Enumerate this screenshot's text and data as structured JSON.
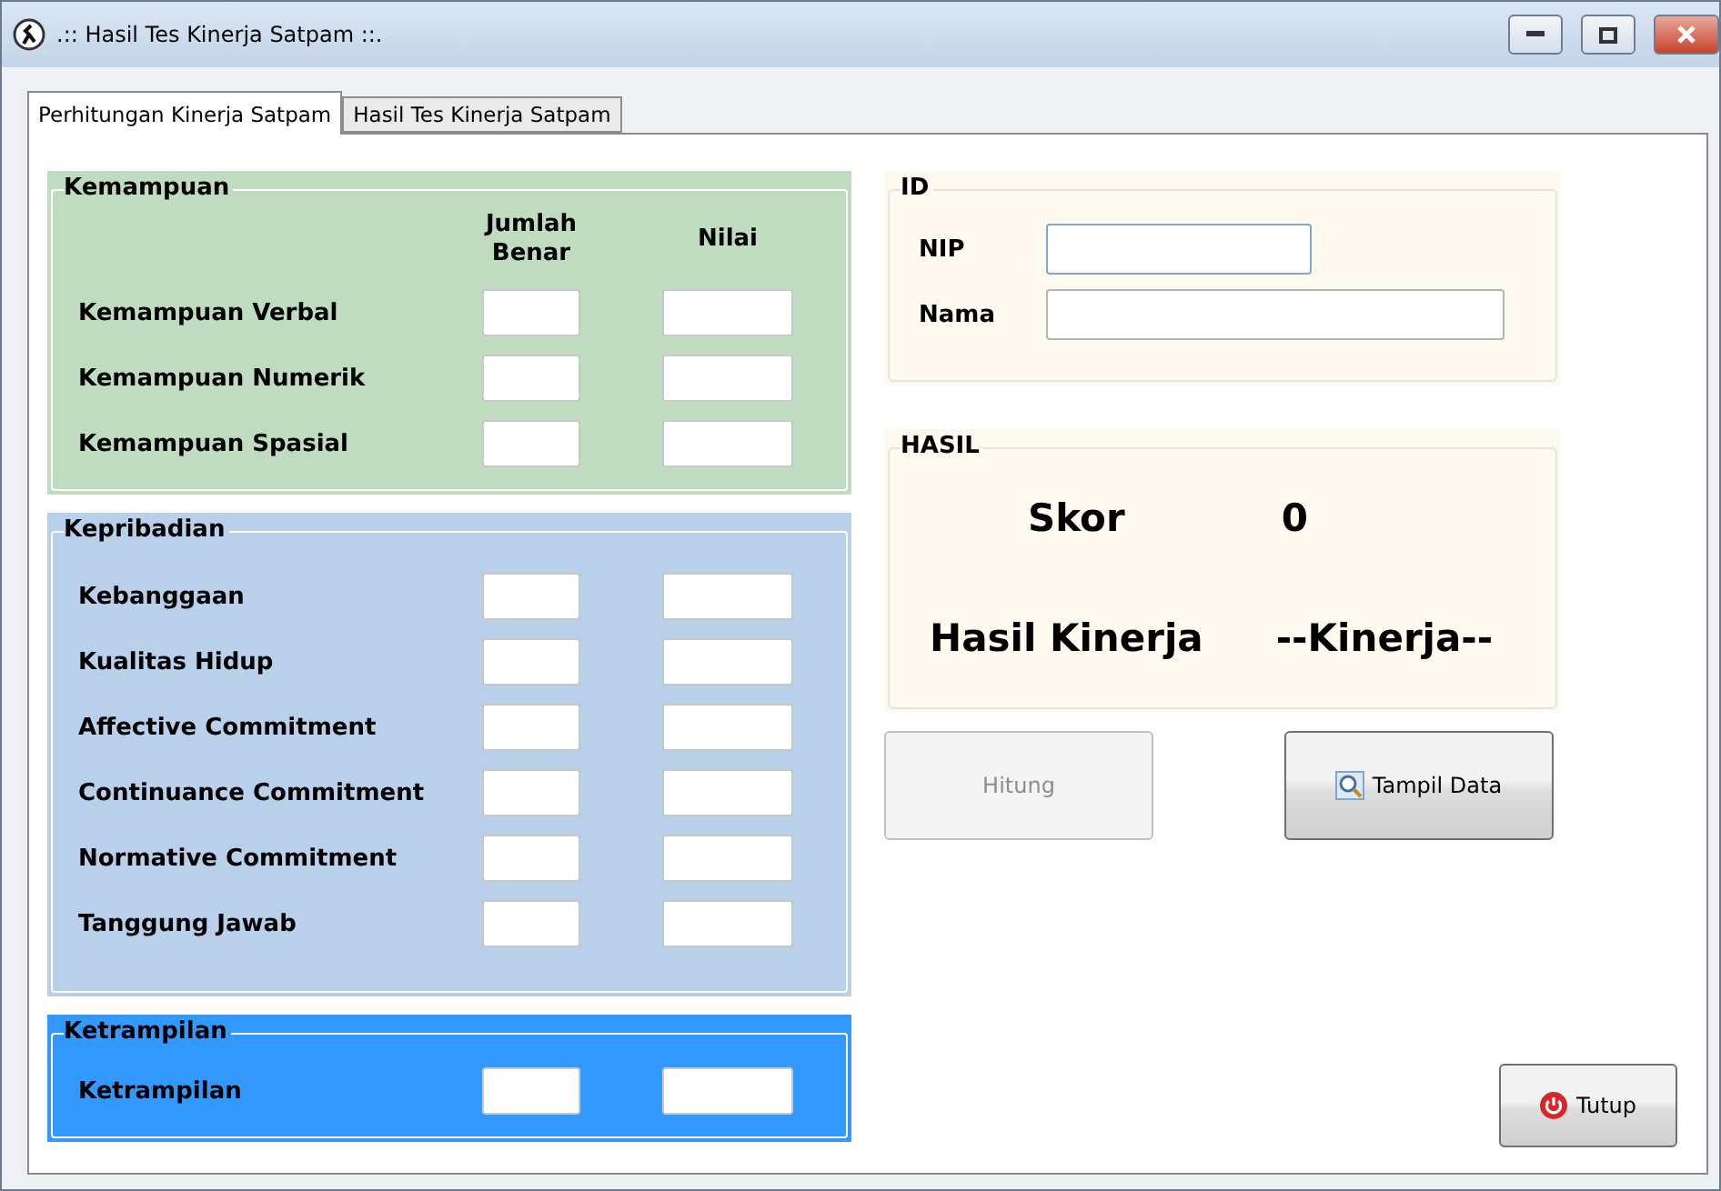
{
  "window": {
    "title": ".:: Hasil Tes Kinerja Satpam ::."
  },
  "tabs": [
    {
      "label": "Perhitungan Kinerja Satpam",
      "selected": true
    },
    {
      "label": "Hasil Tes Kinerja Satpam",
      "selected": false
    }
  ],
  "groups": [
    {
      "kind": "kemampuan",
      "title": "Kemampuan",
      "columns": [
        "Jumlah Benar",
        "Nilai"
      ],
      "rows": [
        "Kemampuan Verbal",
        "Kemampuan Numerik",
        "Kemampuan Spasial"
      ]
    },
    {
      "kind": "kepribadian",
      "title": "Kepribadian",
      "rows": [
        "Kebanggaan",
        "Kualitas Hidup",
        "Affective Commitment",
        "Continuance Commitment",
        "Normative Commitment",
        "Tanggung Jawab"
      ]
    },
    {
      "kind": "ketrampilan",
      "title": "Ketrampilan",
      "rows": [
        "Ketrampilan"
      ]
    }
  ],
  "id_panel": {
    "title": "ID",
    "fields": [
      {
        "label": "NIP",
        "focused": true,
        "wide": false
      },
      {
        "label": "Nama",
        "focused": false,
        "wide": true
      }
    ]
  },
  "hasil": {
    "title": "HASIL",
    "skor_label": "Skor",
    "skor": "0",
    "kinerja_label": "Hasil Kinerja",
    "kinerja": "--Kinerja--"
  },
  "buttons": [
    {
      "label": "Hitung",
      "disabled": true
    },
    {
      "label": "Tampil Data",
      "disabled": false
    }
  ],
  "close_button": {
    "label": "Tutup"
  }
}
